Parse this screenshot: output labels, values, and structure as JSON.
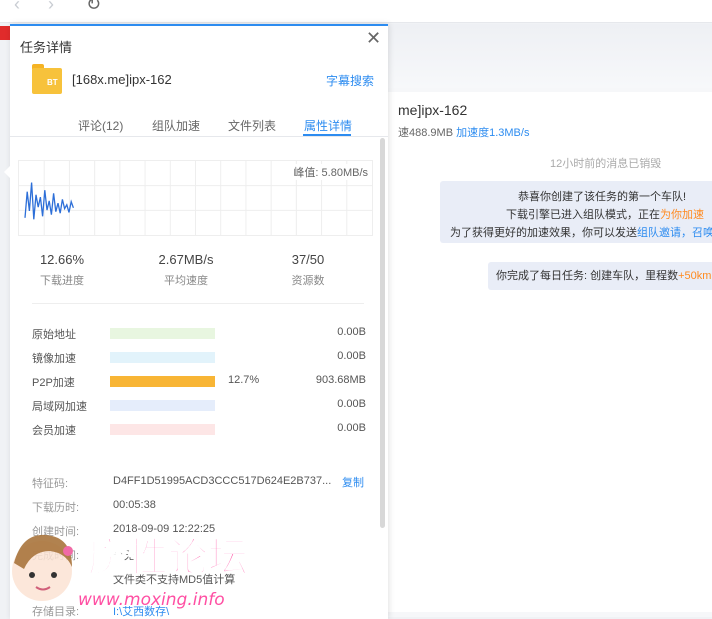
{
  "browser": {
    "back_icon": "chevron-left-icon",
    "forward_icon": "chevron-right-icon",
    "reload_icon": "refresh-icon"
  },
  "background_chat": {
    "title": "me]ipx-162",
    "stats_prefix": "速488.9MB",
    "stats_accel": "加速度1.3MB/s",
    "notice": "12小时前的消息已销毁",
    "msg1_line1": "恭喜你创建了该任务的第一个车队!",
    "msg1_line2_a": "下载引擎已进入组队模式，正在",
    "msg1_line2_b": "为你加速",
    "msg1_line3_a": "为了获得更好的加速效果，你可以发送",
    "msg1_line3_b": "组队邀请，召唤",
    "msg2_a": "你完成了每日任务: 创建车队，里程数",
    "msg2_b": "+50km"
  },
  "panel": {
    "title": "任务详情",
    "close_icon": "close-icon",
    "file_icon": "folder-bt-icon",
    "file_badge": "BT",
    "filename": "[168x.me]ipx-162",
    "subtitle_search": "字幕搜索",
    "tabs": [
      {
        "label": "评论(12)",
        "active": false
      },
      {
        "label": "组队加速",
        "active": false
      },
      {
        "label": "文件列表",
        "active": false
      },
      {
        "label": "属性详情",
        "active": true
      }
    ],
    "peak_label": "峰值: 5.80MB/s",
    "stats": [
      {
        "value": "12.66%",
        "label": "下载进度"
      },
      {
        "value": "2.67MB/s",
        "label": "平均速度"
      },
      {
        "value": "37/50",
        "label": "资源数"
      }
    ],
    "sources": [
      {
        "name": "原始地址",
        "color": "#e8f6e0",
        "fill": 0,
        "pct": "",
        "size": "0.00B"
      },
      {
        "name": "镜像加速",
        "color": "#e2f3fb",
        "fill": 0,
        "pct": "",
        "size": "0.00B"
      },
      {
        "name": "P2P加速",
        "color": "#f8b535",
        "fill": 1,
        "pct": "12.7%",
        "size": "903.68MB"
      },
      {
        "name": "局域网加速",
        "color": "#e5edfb",
        "fill": 0,
        "pct": "",
        "size": "0.00B"
      },
      {
        "name": "会员加速",
        "color": "#fde6e6",
        "fill": 0,
        "pct": "",
        "size": "0.00B"
      }
    ],
    "details": {
      "hash_label": "特征码:",
      "hash_value": "D4FF1D51995ACD3CCC517D624E2B737...",
      "copy": "复制",
      "elapsed_label": "下载历时:",
      "elapsed_value": "00:05:38",
      "created_label": "创建时间:",
      "created_value": "2018-09-09 12:22:25",
      "completed_label": "完成时间:",
      "completed_value": "暂无",
      "md5_value": "文件类不支持MD5值计算",
      "dir_label": "存储目录:",
      "dir_value": "I:\\艾西数存\\"
    }
  },
  "chart_data": {
    "type": "line",
    "series": [
      {
        "values": [
          1.2,
          4.6,
          2.1,
          5.8,
          1.0,
          4.2,
          2.6,
          3.9,
          1.4,
          4.8,
          2.2,
          3.4,
          1.6,
          4.4,
          2.0,
          3.1,
          1.8,
          3.6,
          2.4,
          2.9,
          1.9,
          3.3,
          2.5
        ]
      }
    ],
    "ylim": [
      0,
      6
    ],
    "color": "#2d6fd8"
  },
  "watermark": {
    "text": "魔性论坛",
    "url": "www.moxing.info"
  }
}
